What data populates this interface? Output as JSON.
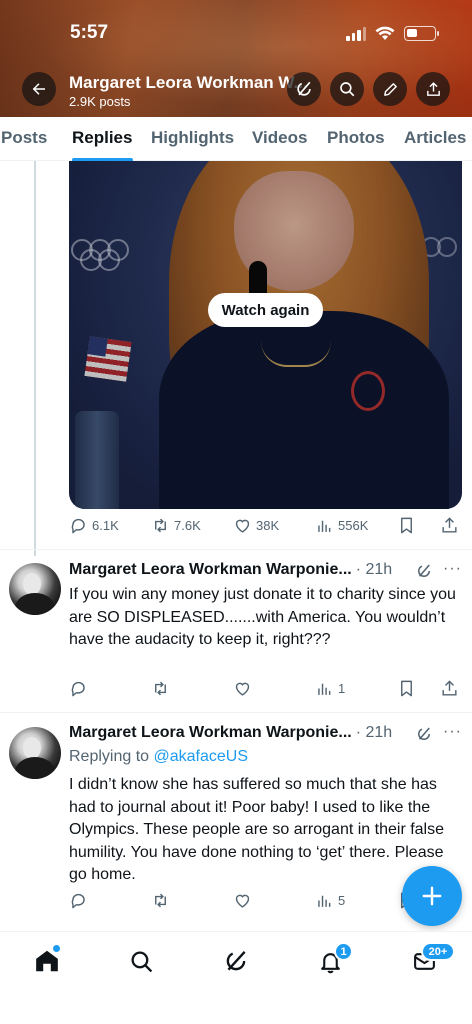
{
  "status_bar": {
    "time": "5:57"
  },
  "header": {
    "name": "Margaret Leora Workman W...",
    "posts": "2.9K posts"
  },
  "tabs": [
    "Posts",
    "Replies",
    "Highlights",
    "Videos",
    "Photos",
    "Articles"
  ],
  "active_tab": "Replies",
  "video_post": {
    "watch_again_label": "Watch again",
    "replies": "6.1K",
    "reposts": "7.6K",
    "likes": "38K",
    "views": "556K"
  },
  "tweets": [
    {
      "name": "Margaret Leora Workman Warponie...",
      "time": "· 21h",
      "more": "···",
      "body": "If you win any money just donate it to charity since you are SO DISPLEASED.......with America. You wouldn’t have the audacity to keep it, right???",
      "views": "1"
    },
    {
      "name": "Margaret Leora Workman Warponie...",
      "time": "· 21h",
      "more": "···",
      "reply_prefix": "Replying to ",
      "reply_handle": "@akafaceUS",
      "body": "I didn’t know she has suffered so much that she has had to journal about it! Poor baby! I used to like the Olympics. These people are so arrogant in their false humility. You have done nothing to ‘get’ there. Please go home.",
      "views": "5"
    }
  ],
  "bottom_nav": {
    "notifications_badge": "1",
    "messages_badge": "20+"
  },
  "colors": {
    "accent": "#1d9bf0",
    "text_primary": "#0f1419",
    "text_secondary": "#536471"
  },
  "icons": [
    "back-arrow-icon",
    "grok-icon",
    "search-icon",
    "pencil-icon",
    "share-icon",
    "reply-icon",
    "repost-icon",
    "like-icon",
    "views-icon",
    "bookmark-icon",
    "home-icon",
    "bell-icon",
    "mail-icon",
    "plus-icon"
  ]
}
